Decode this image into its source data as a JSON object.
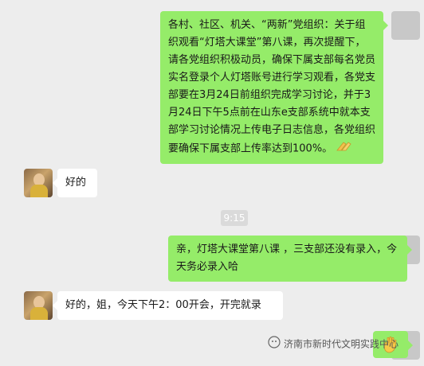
{
  "messages": [
    {
      "direction": "outgoing",
      "text": "各村、社区、机关、“两新”党组织：关于组织观看“灯塔大课堂”第八课，再次提醒下，请各党组织积极动员，确保下属支部每名党员实名登录个人灯塔账号进行学习观看，各党支部要在3月24日前组织完成学习讨论，并于3月24日下午5点前在山东e支部系统中就本支部学习讨论情况上传电子日志信息，各党组织要确保下属支部上传率达到100%。",
      "emoji": "praying-hands"
    },
    {
      "direction": "incoming",
      "text": "好的"
    },
    {
      "direction": "outgoing",
      "text": "亲，灯塔大课堂第八课 ，三支部还没有录入，今天务必录入哈"
    },
    {
      "direction": "incoming",
      "text": "好的，姐，今天下午2：00开会，开完就录"
    },
    {
      "direction": "outgoing",
      "emoji": "waving-hand"
    }
  ],
  "timestamp": "9:15",
  "watermark": {
    "text": "济南市新时代文明实践中心",
    "icon": "wechat-official-account-icon"
  },
  "colors": {
    "background": "#ededed",
    "outgoing_bubble": "#95ec69",
    "incoming_bubble": "#ffffff"
  }
}
